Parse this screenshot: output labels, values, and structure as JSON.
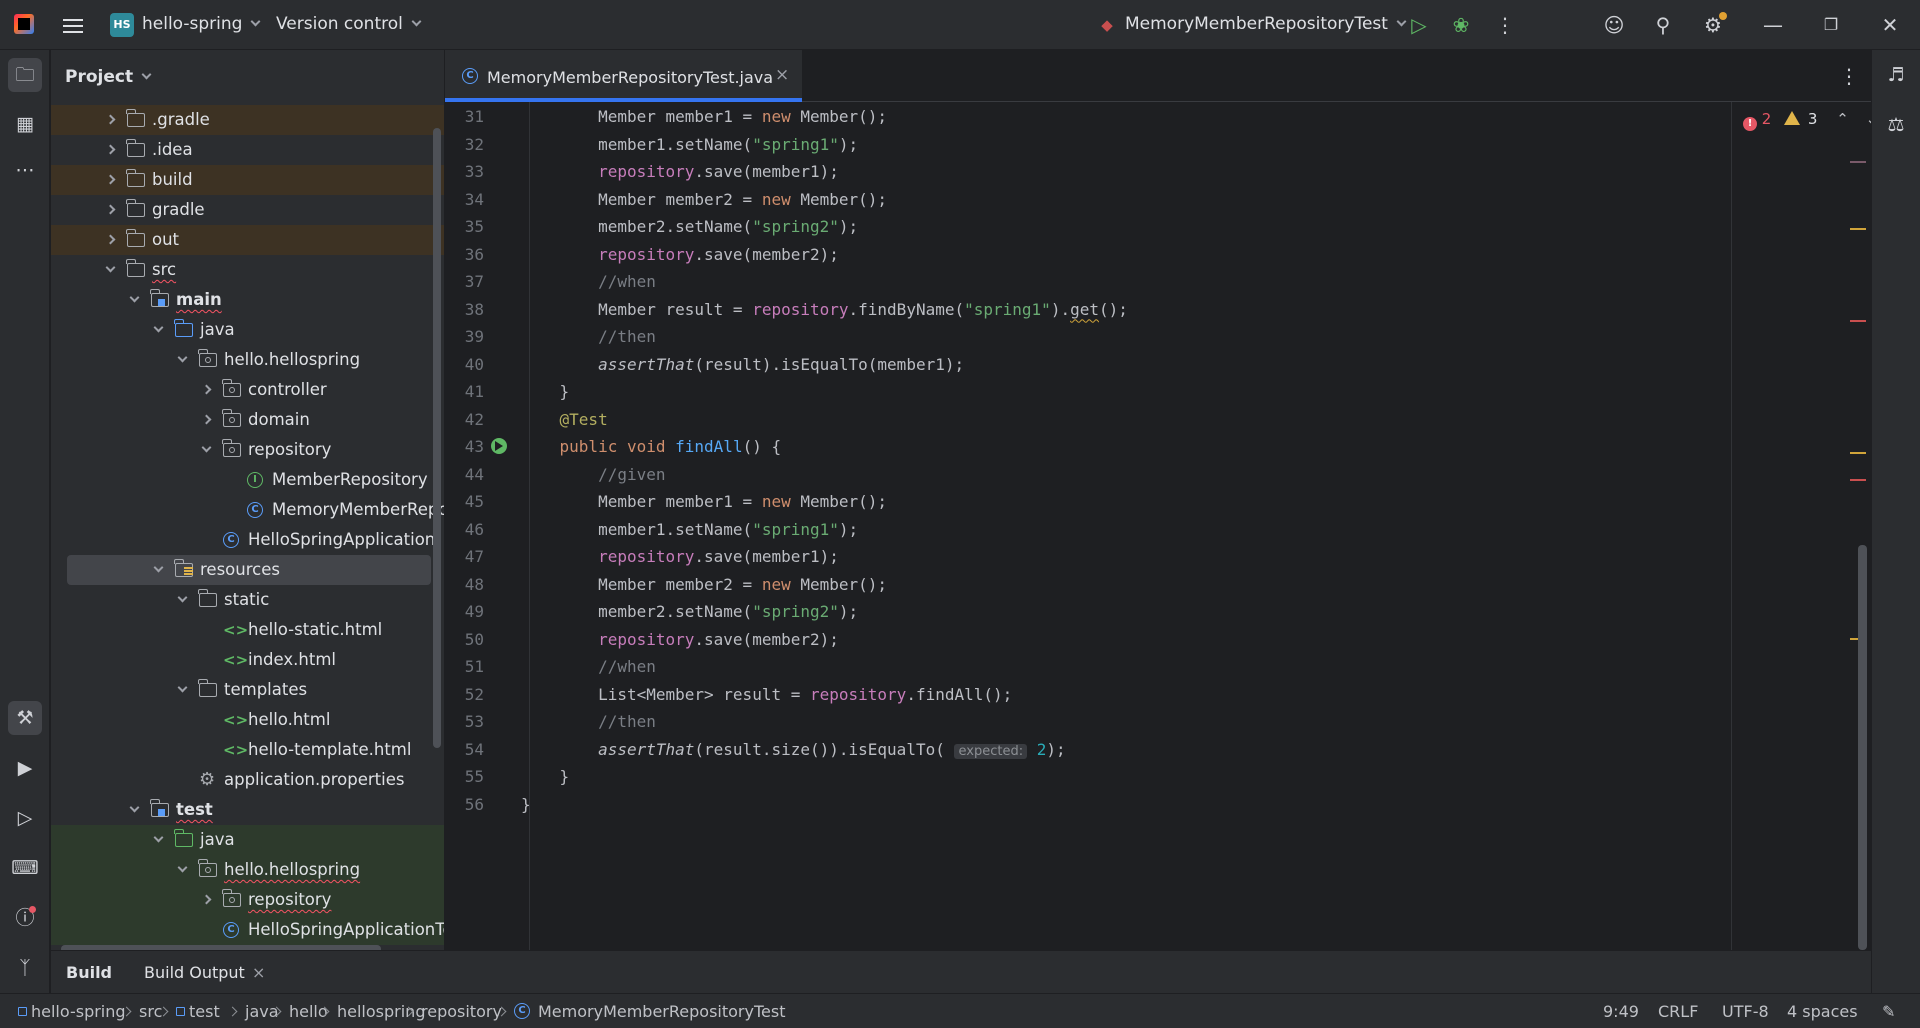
{
  "titlebar": {
    "project_badge": "HS",
    "project_name": "hello-spring",
    "vcs": "Version control",
    "run_config": "MemoryMemberRepositoryTest"
  },
  "project_panel": {
    "title": "Project",
    "tree": [
      {
        "label": ".gradle",
        "depth": 2,
        "arrow": "r",
        "icon": "folder",
        "style": "excluded"
      },
      {
        "label": ".idea",
        "depth": 2,
        "arrow": "r",
        "icon": "folder",
        "style": ""
      },
      {
        "label": "build",
        "depth": 2,
        "arrow": "r",
        "icon": "folder",
        "style": "excluded"
      },
      {
        "label": "gradle",
        "depth": 2,
        "arrow": "r",
        "icon": "folder",
        "style": ""
      },
      {
        "label": "out",
        "depth": 2,
        "arrow": "r",
        "icon": "folder",
        "style": "excluded"
      },
      {
        "label": "src",
        "depth": 2,
        "arrow": "d",
        "icon": "folder",
        "style": "",
        "wavy": true
      },
      {
        "label": "main",
        "depth": 3,
        "arrow": "d",
        "icon": "module",
        "style": "",
        "bold": true,
        "wavy": true
      },
      {
        "label": "java",
        "depth": 4,
        "arrow": "d",
        "icon": "folder-blue",
        "style": ""
      },
      {
        "label": "hello.hellospring",
        "depth": 5,
        "arrow": "d",
        "icon": "package",
        "style": ""
      },
      {
        "label": "controller",
        "depth": 6,
        "arrow": "r",
        "icon": "package",
        "style": ""
      },
      {
        "label": "domain",
        "depth": 6,
        "arrow": "r",
        "icon": "package",
        "style": ""
      },
      {
        "label": "repository",
        "depth": 6,
        "arrow": "d",
        "icon": "package",
        "style": ""
      },
      {
        "label": "MemberRepository",
        "depth": 7,
        "arrow": "",
        "icon": "interface",
        "style": ""
      },
      {
        "label": "MemoryMemberRepository",
        "depth": 7,
        "arrow": "",
        "icon": "class",
        "style": ""
      },
      {
        "label": "HelloSpringApplication",
        "depth": 6,
        "arrow": "",
        "icon": "class",
        "style": ""
      },
      {
        "label": "resources",
        "depth": 4,
        "arrow": "d",
        "icon": "resources",
        "style": "selected"
      },
      {
        "label": "static",
        "depth": 5,
        "arrow": "d",
        "icon": "folder",
        "style": ""
      },
      {
        "label": "hello-static.html",
        "depth": 6,
        "arrow": "",
        "icon": "html",
        "style": ""
      },
      {
        "label": "index.html",
        "depth": 6,
        "arrow": "",
        "icon": "html",
        "style": ""
      },
      {
        "label": "templates",
        "depth": 5,
        "arrow": "d",
        "icon": "folder",
        "style": ""
      },
      {
        "label": "hello.html",
        "depth": 6,
        "arrow": "",
        "icon": "html",
        "style": ""
      },
      {
        "label": "hello-template.html",
        "depth": 6,
        "arrow": "",
        "icon": "html",
        "style": ""
      },
      {
        "label": "application.properties",
        "depth": 5,
        "arrow": "",
        "icon": "gear",
        "style": ""
      },
      {
        "label": "test",
        "depth": 3,
        "arrow": "d",
        "icon": "module",
        "style": "",
        "bold": true,
        "wavy": true
      },
      {
        "label": "java",
        "depth": 4,
        "arrow": "d",
        "icon": "folder-green",
        "style": "testsrc"
      },
      {
        "label": "hello.hellospring",
        "depth": 5,
        "arrow": "d",
        "icon": "package",
        "style": "testsrc",
        "wavy": true
      },
      {
        "label": "repository",
        "depth": 6,
        "arrow": "r",
        "icon": "package",
        "style": "testsrc",
        "wavy": true
      },
      {
        "label": "HelloSpringApplicationTests",
        "depth": 6,
        "arrow": "",
        "icon": "class",
        "style": "testsrc"
      }
    ]
  },
  "editor": {
    "tab_label": "MemoryMemberRepositoryTest.java",
    "errors": "2",
    "warnings": "3",
    "lines": [
      {
        "n": "31",
        "html": "        Member member1 = <span class='k'>new</span> Member();"
      },
      {
        "n": "32",
        "html": "        member1.setName(<span class='s'>\"spring1\"</span>);"
      },
      {
        "n": "33",
        "html": "        <span class='f'>repository</span>.save(member1);"
      },
      {
        "n": "34",
        "html": "        Member member2 = <span class='k'>new</span> Member();"
      },
      {
        "n": "35",
        "html": "        member2.setName(<span class='s'>\"spring2\"</span>);"
      },
      {
        "n": "36",
        "html": "        <span class='f'>repository</span>.save(member2);"
      },
      {
        "n": "37",
        "html": "        <span class='cm'>//when</span>"
      },
      {
        "n": "38",
        "html": "        Member result = <span class='f'>repository</span>.findByName(<span class='s'>\"spring1\"</span>).<span class='ul'>get</span>();"
      },
      {
        "n": "39",
        "html": "        <span class='cm'>//then</span>"
      },
      {
        "n": "40",
        "html": "        <span class='it'>assertThat</span>(result).isEqualTo(member1);"
      },
      {
        "n": "41",
        "html": "    }"
      },
      {
        "n": "42",
        "html": "    <span class='a'>@Test</span>"
      },
      {
        "n": "43",
        "html": "    <span class='k'>public void</span> <span class='m'>findAll</span>() {"
      },
      {
        "n": "44",
        "html": "        <span class='cm'>//given</span>"
      },
      {
        "n": "45",
        "html": "        Member member1 = <span class='k'>new</span> Member();"
      },
      {
        "n": "46",
        "html": "        member1.setName(<span class='s'>\"spring1\"</span>);"
      },
      {
        "n": "47",
        "html": "        <span class='f'>repository</span>.save(member1);"
      },
      {
        "n": "48",
        "html": "        Member member2 = <span class='k'>new</span> Member();"
      },
      {
        "n": "49",
        "html": "        member2.setName(<span class='s'>\"spring2\"</span>);"
      },
      {
        "n": "50",
        "html": "        <span class='f'>repository</span>.save(member2);"
      },
      {
        "n": "51",
        "html": "        <span class='cm'>//when</span>"
      },
      {
        "n": "52",
        "html": "        List&lt;Member&gt; result = <span class='f'>repository</span>.findAll();"
      },
      {
        "n": "53",
        "html": "        <span class='cm'>//then</span>"
      },
      {
        "n": "54",
        "html": "        <span class='it'>assertThat</span>(result.size()).isEqualTo( <span class='hint'>expected:</span> <span class='n'>2</span>);"
      },
      {
        "n": "55",
        "html": "    }"
      },
      {
        "n": "56",
        "html": "}"
      }
    ]
  },
  "build_bar": {
    "build": "Build",
    "build_output": "Build Output"
  },
  "statusbar": {
    "breadcrumbs": [
      "hello-spring",
      "src",
      "test",
      "java",
      "hello",
      "hellospring",
      "repository",
      "MemoryMemberRepositoryTest"
    ],
    "position": "9:49",
    "line_sep": "CRLF",
    "encoding": "UTF-8",
    "indent": "4 spaces"
  }
}
